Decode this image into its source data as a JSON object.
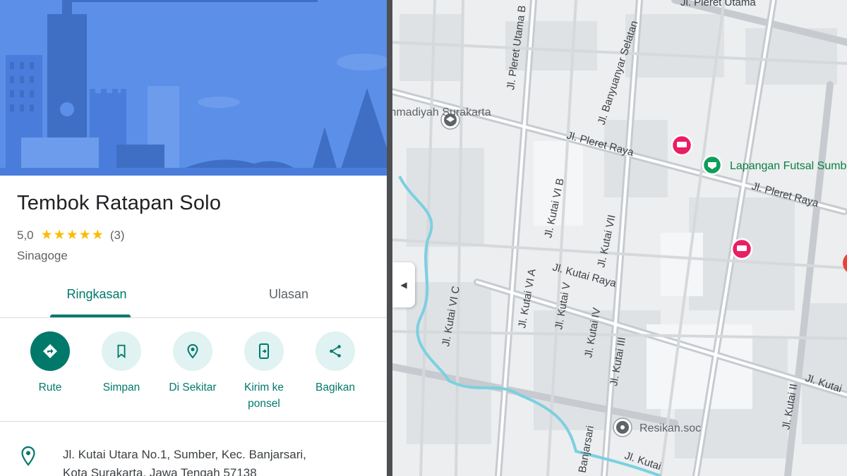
{
  "place": {
    "title": "Tembok Ratapan Solo",
    "rating": "5,0",
    "stars": "★★★★★",
    "review_count": "(3)",
    "category": "Sinagoge",
    "address_line1": "Jl. Kutai Utara No.1, Sumber, Kec. Banjarsari,",
    "address_line2": "Kota Surakarta, Jawa Tengah 57138"
  },
  "tabs": [
    {
      "label": "Ringkasan",
      "active": true
    },
    {
      "label": "Ulasan",
      "active": false
    }
  ],
  "actions": [
    {
      "label": "Rute",
      "icon": "directions-icon"
    },
    {
      "label": "Simpan",
      "icon": "bookmark-icon"
    },
    {
      "label": "Di Sekitar",
      "icon": "nearby-icon"
    },
    {
      "label": "Kirim ke ponsel",
      "icon": "send-to-phone-icon"
    },
    {
      "label": "Bagikan",
      "icon": "share-icon"
    }
  ],
  "map": {
    "road_labels": [
      "Jl. Pleret Utama",
      "Jl. Pleret Utama B",
      "Jl. Banyuanyar Selatan",
      "Jl. Pleret Raya",
      "Jl. Pleret Raya",
      "Jl. Kutai VI B",
      "Jl. Kutai VII",
      "Jl. Kutai Raya",
      "Jl. Kutai VI C",
      "Jl. Kutai VI A",
      "Jl. Kutai V",
      "Jl. Kutai IV",
      "Jl. Kutai III",
      "Jl. Kutai II",
      "Jl. Kutai",
      "Jl. Banjarsari",
      "Jl. Kutai"
    ],
    "pois": [
      {
        "label": "Lapangan Futsal Sumber",
        "type": "sports",
        "color": "#0f9d58"
      },
      {
        "label": "Resikan.soc",
        "type": "store",
        "color": "#5f6368"
      },
      {
        "label": "Muhammadiyah Surakarta",
        "type": "school",
        "color": "#5f6368"
      },
      {
        "label": "",
        "type": "hotel",
        "color": "#e91e63"
      },
      {
        "label": "",
        "type": "hotel",
        "color": "#e91e63"
      }
    ]
  },
  "colors": {
    "accent": "#00796b",
    "accent_light": "#e0f2f1",
    "star": "#fbbc04",
    "hero_blue": "#5b8fe8"
  }
}
